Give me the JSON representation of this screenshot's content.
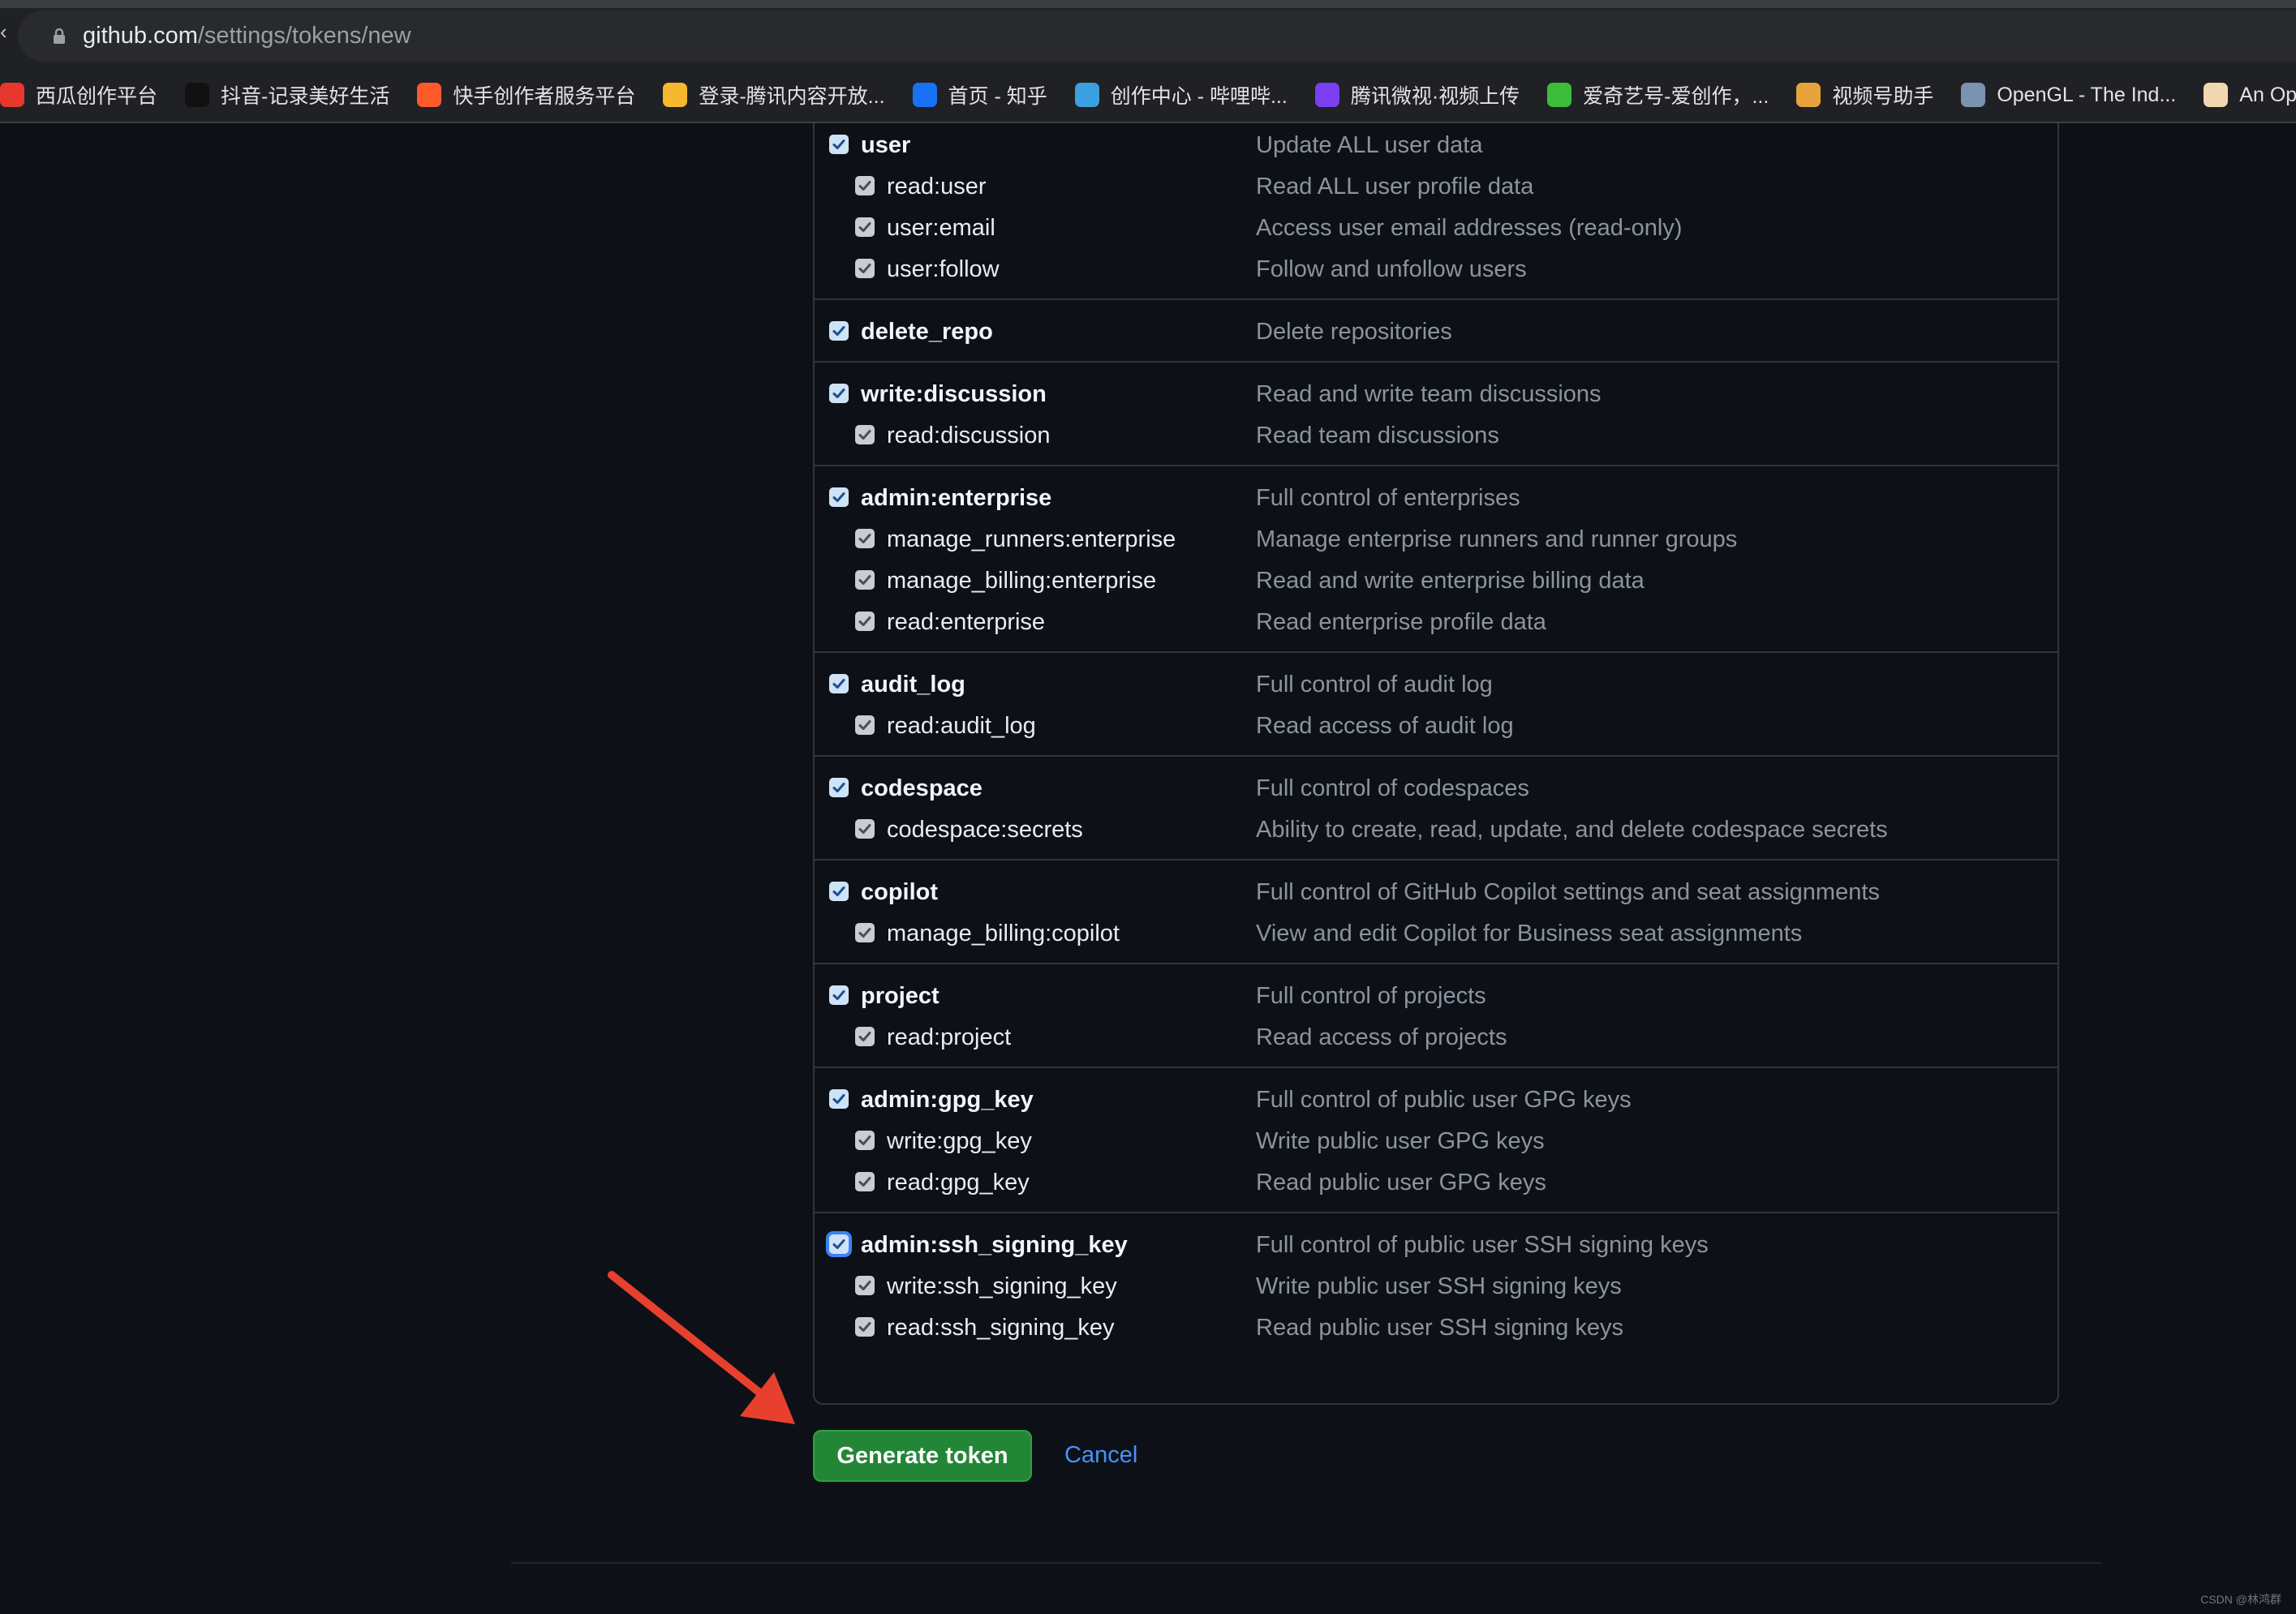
{
  "browser": {
    "url_host": "github.com",
    "url_path": "/settings/tokens/new",
    "bookmarks": [
      {
        "label": "西瓜创作平台",
        "icon": "xigua-icon",
        "color": "#e8372f"
      },
      {
        "label": "抖音-记录美好生活",
        "icon": "douyin-icon",
        "color": "#111111"
      },
      {
        "label": "快手创作者服务平台",
        "icon": "kuaishou-icon",
        "color": "#ff5a2c"
      },
      {
        "label": "登录-腾讯内容开放...",
        "icon": "bell-icon",
        "color": "#f5b82e"
      },
      {
        "label": "首页 - 知乎",
        "icon": "zhihu-icon",
        "color": "#1772f6"
      },
      {
        "label": "创作中心 - 哔哩哔...",
        "icon": "bilibili-icon",
        "color": "#3b9fe0"
      },
      {
        "label": "腾讯微视·视频上传",
        "icon": "weishi-icon",
        "color": "#7a3ff0"
      },
      {
        "label": "爱奇艺号-爱创作，...",
        "icon": "iqiyi-icon",
        "color": "#3bbd3b"
      },
      {
        "label": "视频号助手",
        "icon": "channels-icon",
        "color": "#e8a33c"
      },
      {
        "label": "OpenGL - The Ind...",
        "icon": "opengl-icon",
        "color": "#7a93b0"
      },
      {
        "label": "An Oper",
        "icon": "sushi-icon",
        "color": "#f1d7b0"
      }
    ]
  },
  "scope_groups": [
    {
      "scope": "user",
      "description": "Update ALL user data",
      "checked": true,
      "children": [
        {
          "scope": "read:user",
          "description": "Read ALL user profile data",
          "checked": true
        },
        {
          "scope": "user:email",
          "description": "Access user email addresses (read-only)",
          "checked": true
        },
        {
          "scope": "user:follow",
          "description": "Follow and unfollow users",
          "checked": true
        }
      ]
    },
    {
      "scope": "delete_repo",
      "description": "Delete repositories",
      "checked": true,
      "children": []
    },
    {
      "scope": "write:discussion",
      "description": "Read and write team discussions",
      "checked": true,
      "children": [
        {
          "scope": "read:discussion",
          "description": "Read team discussions",
          "checked": true
        }
      ]
    },
    {
      "scope": "admin:enterprise",
      "description": "Full control of enterprises",
      "checked": true,
      "children": [
        {
          "scope": "manage_runners:enterprise",
          "description": "Manage enterprise runners and runner groups",
          "checked": true
        },
        {
          "scope": "manage_billing:enterprise",
          "description": "Read and write enterprise billing data",
          "checked": true
        },
        {
          "scope": "read:enterprise",
          "description": "Read enterprise profile data",
          "checked": true
        }
      ]
    },
    {
      "scope": "audit_log",
      "description": "Full control of audit log",
      "checked": true,
      "children": [
        {
          "scope": "read:audit_log",
          "description": "Read access of audit log",
          "checked": true
        }
      ]
    },
    {
      "scope": "codespace",
      "description": "Full control of codespaces",
      "checked": true,
      "children": [
        {
          "scope": "codespace:secrets",
          "description": "Ability to create, read, update, and delete codespace secrets",
          "checked": true
        }
      ]
    },
    {
      "scope": "copilot",
      "description": "Full control of GitHub Copilot settings and seat assignments",
      "checked": true,
      "children": [
        {
          "scope": "manage_billing:copilot",
          "description": "View and edit Copilot for Business seat assignments",
          "checked": true
        }
      ]
    },
    {
      "scope": "project",
      "description": "Full control of projects",
      "checked": true,
      "children": [
        {
          "scope": "read:project",
          "description": "Read access of projects",
          "checked": true
        }
      ]
    },
    {
      "scope": "admin:gpg_key",
      "description": "Full control of public user GPG keys",
      "checked": true,
      "children": [
        {
          "scope": "write:gpg_key",
          "description": "Write public user GPG keys",
          "checked": true
        },
        {
          "scope": "read:gpg_key",
          "description": "Read public user GPG keys",
          "checked": true
        }
      ]
    },
    {
      "scope": "admin:ssh_signing_key",
      "description": "Full control of public user SSH signing keys",
      "checked": true,
      "focused": true,
      "children": [
        {
          "scope": "write:ssh_signing_key",
          "description": "Write public user SSH signing keys",
          "checked": true
        },
        {
          "scope": "read:ssh_signing_key",
          "description": "Read public user SSH signing keys",
          "checked": true
        }
      ]
    }
  ],
  "actions": {
    "generate_label": "Generate token",
    "cancel_label": "Cancel"
  },
  "watermark": "CSDN @林鸿群",
  "colors": {
    "page_bg": "#0d1117",
    "primary_button": "#238636",
    "link": "#4493f8",
    "annotation_arrow": "#e8402f"
  }
}
